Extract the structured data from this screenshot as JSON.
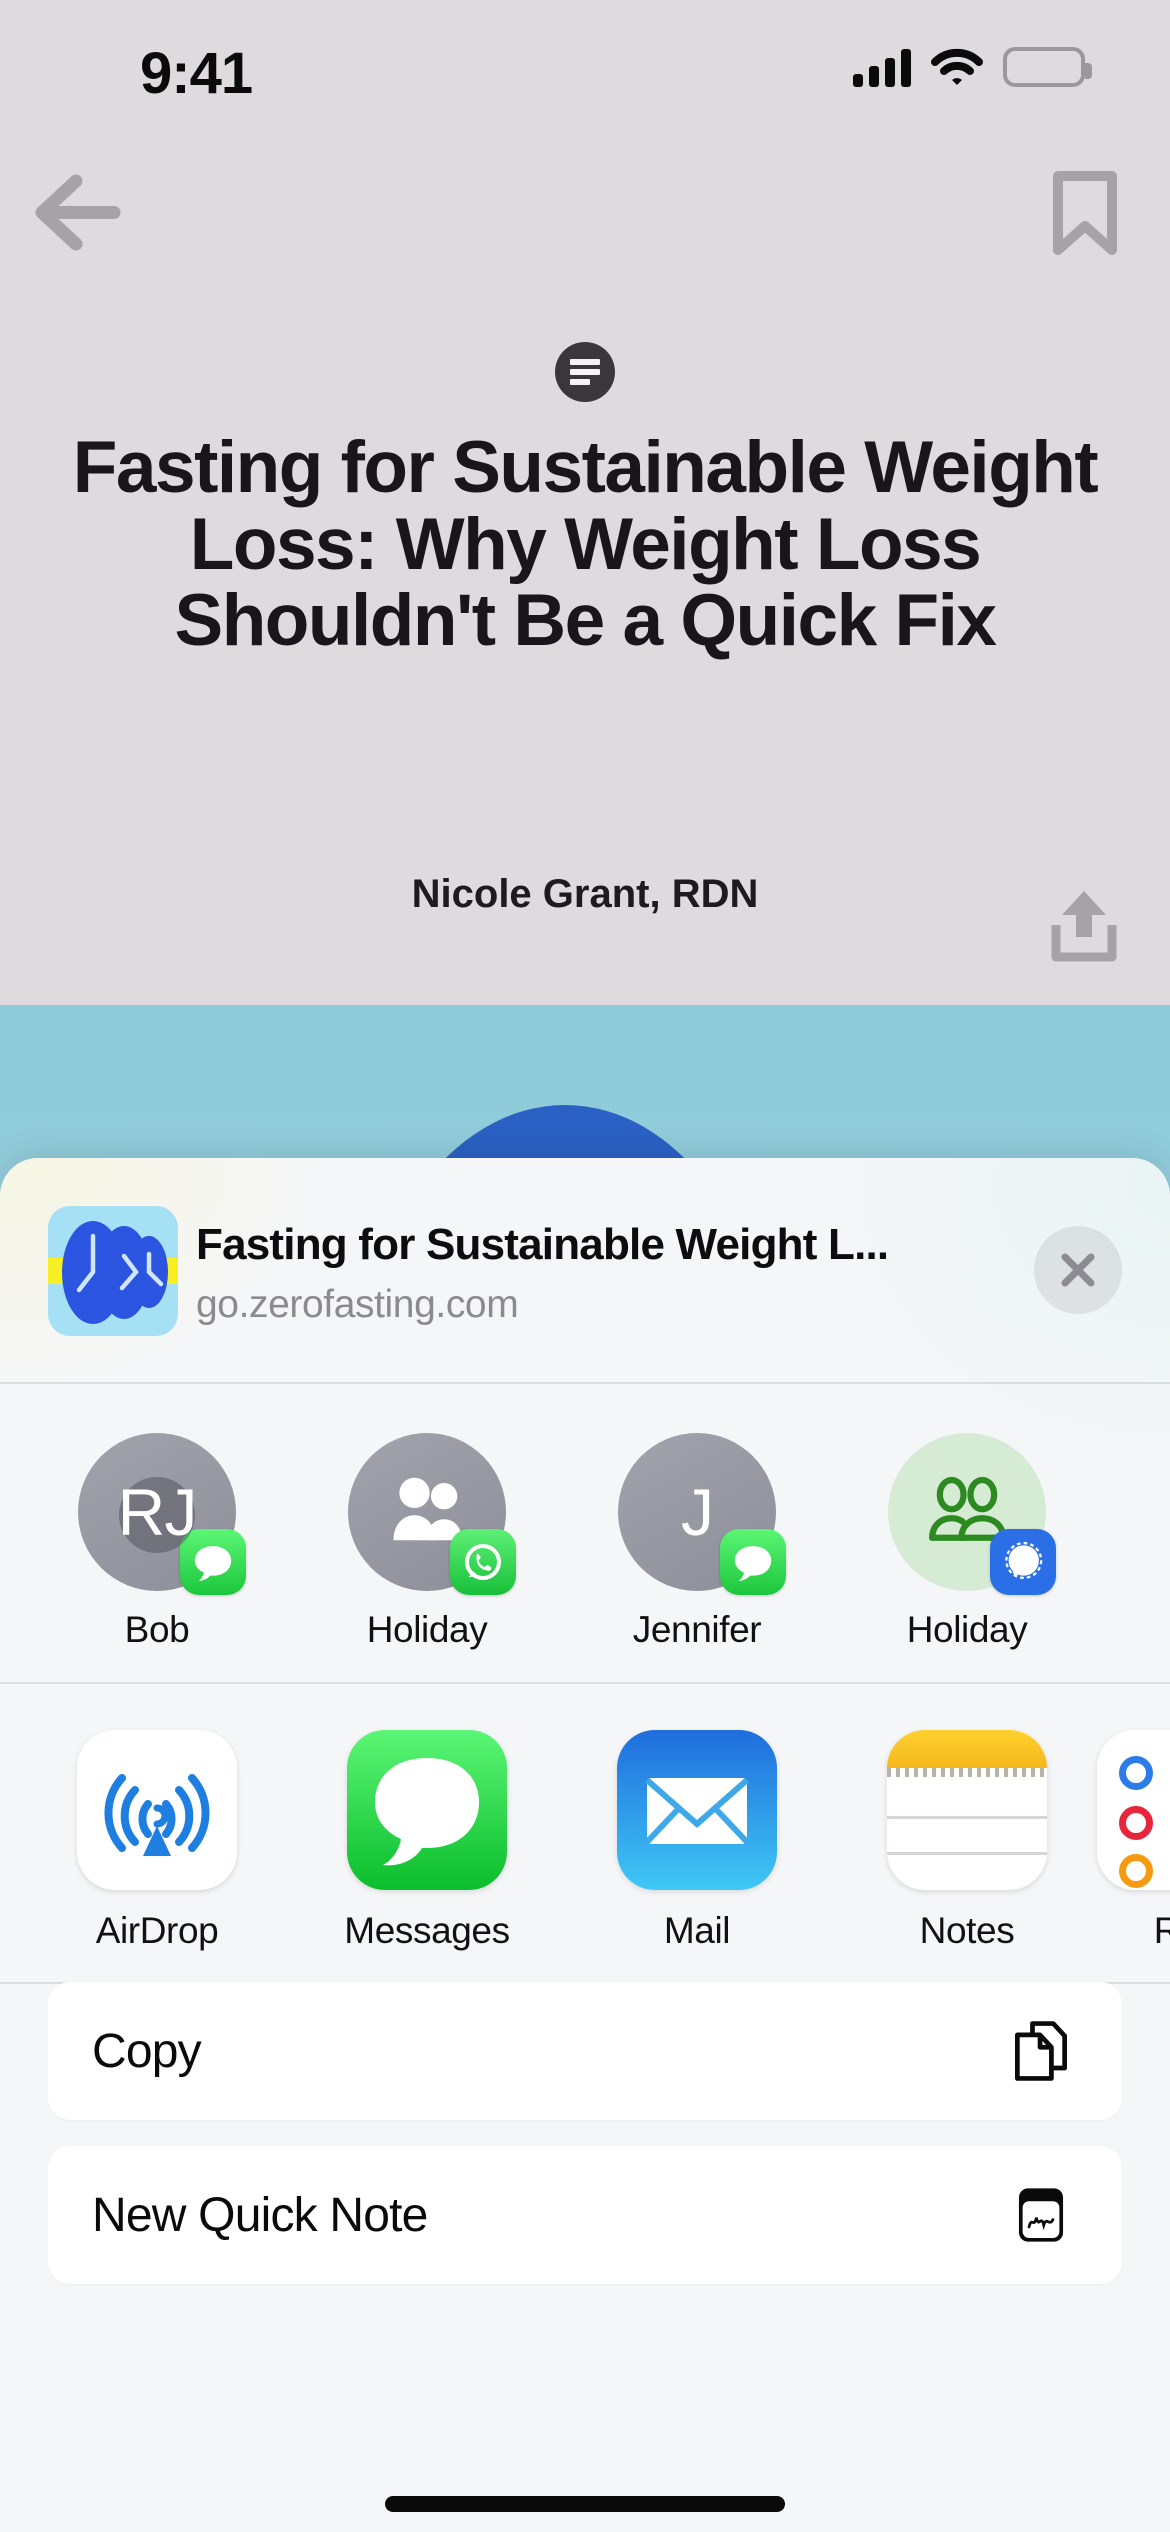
{
  "status_bar": {
    "time": "9:41",
    "signal_icon": "cellular-signal-icon",
    "wifi_icon": "wifi-icon",
    "battery_icon": "battery-full-icon"
  },
  "article": {
    "back_icon": "back-arrow-icon",
    "bookmark_icon": "bookmark-icon",
    "reader_badge_icon": "reader-article-icon",
    "title": "Fasting for Sustainable Weight Loss: Why Weight Loss Shouldn't Be a Quick Fix",
    "author": "Nicole Grant, RDN",
    "share_icon": "share-up-icon"
  },
  "hero": {
    "sky_color": "#8ecada",
    "hill_color": "#2b61c4"
  },
  "share_sheet": {
    "preview": {
      "app_icon": "zero-fasting-app-icon",
      "title": "Fasting for Sustainable Weight L...",
      "url": "go.zerofasting.com",
      "close_icon": "close-icon"
    },
    "contacts": [
      {
        "name": "Bob",
        "initials": "RJ",
        "avatar_style": "gray",
        "badge_app": "Messages",
        "badge_icon": "messages-badge-icon",
        "has_ghost": true
      },
      {
        "name": "Holiday",
        "initials": "",
        "avatar_style": "gray",
        "badge_app": "WhatsApp",
        "badge_icon": "whatsapp-badge-icon",
        "glyph": "two-people-filled-icon"
      },
      {
        "name": "Jennifer",
        "initials": "J",
        "avatar_style": "gray",
        "badge_app": "Messages",
        "badge_icon": "messages-badge-icon"
      },
      {
        "name": "Holiday",
        "initials": "",
        "avatar_style": "green",
        "badge_app": "Signal",
        "badge_icon": "signal-badge-icon",
        "glyph": "two-people-outline-icon"
      }
    ],
    "apps": [
      {
        "name": "AirDrop",
        "icon": "airdrop-icon"
      },
      {
        "name": "Messages",
        "icon": "messages-icon"
      },
      {
        "name": "Mail",
        "icon": "mail-icon"
      },
      {
        "name": "Notes",
        "icon": "notes-icon"
      },
      {
        "name": "Re",
        "icon": "reminders-icon",
        "truncated": true
      }
    ],
    "actions": [
      {
        "label": "Copy",
        "icon": "copy-documents-icon"
      },
      {
        "label": "New Quick Note",
        "icon": "quick-note-icon"
      }
    ]
  },
  "colors": {
    "sheet_bg": "#f5f6f8",
    "article_bg": "#dedadd",
    "messages_green": "#1cc63c",
    "signal_blue": "#2b6fe6",
    "mail_blue": "#1f6ddd",
    "notes_yellow": "#ffd12e",
    "zero_blue": "#2b55e0",
    "zero_yellow": "#f7ef23",
    "zero_bg": "#a5e0f5"
  }
}
